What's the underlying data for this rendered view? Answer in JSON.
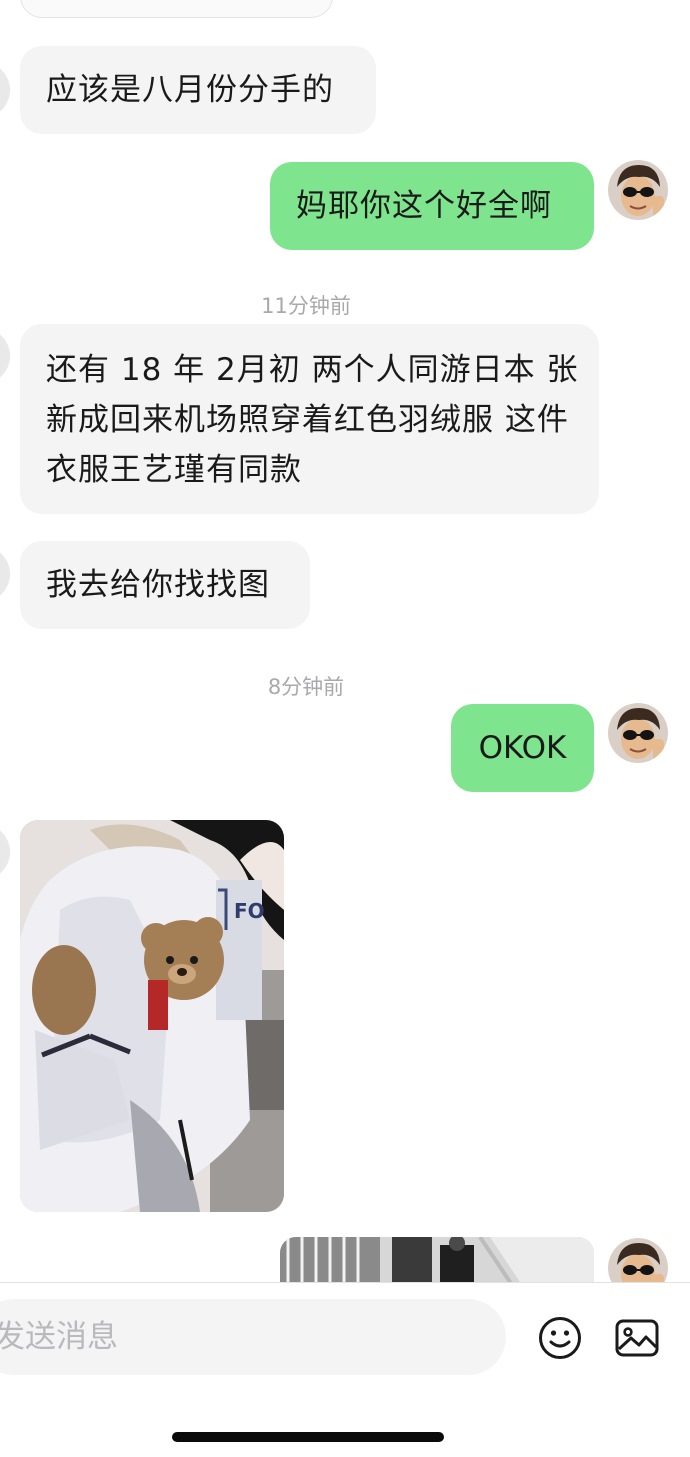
{
  "messages": [
    {
      "from": "peer",
      "text": "应该是八月份分手的"
    },
    {
      "from": "me",
      "text": "妈耶你这个好全啊"
    },
    {
      "type": "time",
      "text": "11分钟前"
    },
    {
      "from": "peer",
      "text": "还有 18 年 2月初 两个人同游日本 张新成回来机场照穿着红色羽绒服 这件衣服王艺瑾有同款"
    },
    {
      "from": "peer",
      "text": "我去给你找找图"
    },
    {
      "type": "time",
      "text": "8分钟前"
    },
    {
      "from": "me",
      "text": "OKOK"
    },
    {
      "from": "peer",
      "type": "image",
      "photo_text": "FO"
    },
    {
      "from": "me",
      "type": "image"
    }
  ],
  "input": {
    "placeholder": "发送消息"
  },
  "icons": {
    "emoji": "emoji-icon",
    "image": "image-icon"
  },
  "colors": {
    "outgoing_bubble": "#7ee48d",
    "incoming_bubble": "#f4f4f5",
    "timestamp": "#a9a9ad",
    "background": "#ffffff"
  }
}
